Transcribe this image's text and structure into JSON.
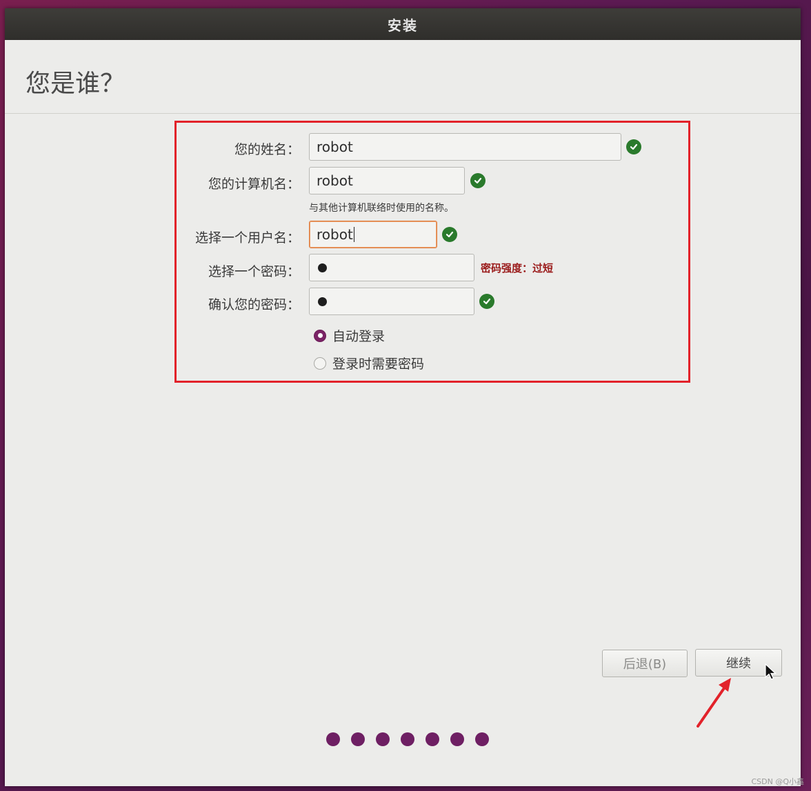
{
  "window": {
    "title": "安装"
  },
  "page": {
    "heading": "您是谁？"
  },
  "form": {
    "name_label": "您的姓名：",
    "name_value": "robot",
    "computer_label": "您的计算机名：",
    "computer_value": "robot",
    "computer_hint": "与其他计算机联络时使用的名称。",
    "username_label": "选择一个用户名：",
    "username_value": "robot",
    "password_label": "选择一个密码：",
    "password_strength": "密码强度：过短",
    "confirm_label": "确认您的密码：",
    "login_auto_label": "自动登录",
    "login_password_label": "登录时需要密码",
    "login_selected": "auto"
  },
  "buttons": {
    "back_label": "后退(B)",
    "continue_label": "继续"
  },
  "progress": {
    "total_steps": 7
  },
  "watermark": "CSDN @Q小鑫",
  "colors": {
    "valid_check": "#2a7a2c",
    "accent_purple": "#7b2366",
    "strength_warning": "#9a1a1a",
    "annotation_red": "#e2222a"
  }
}
